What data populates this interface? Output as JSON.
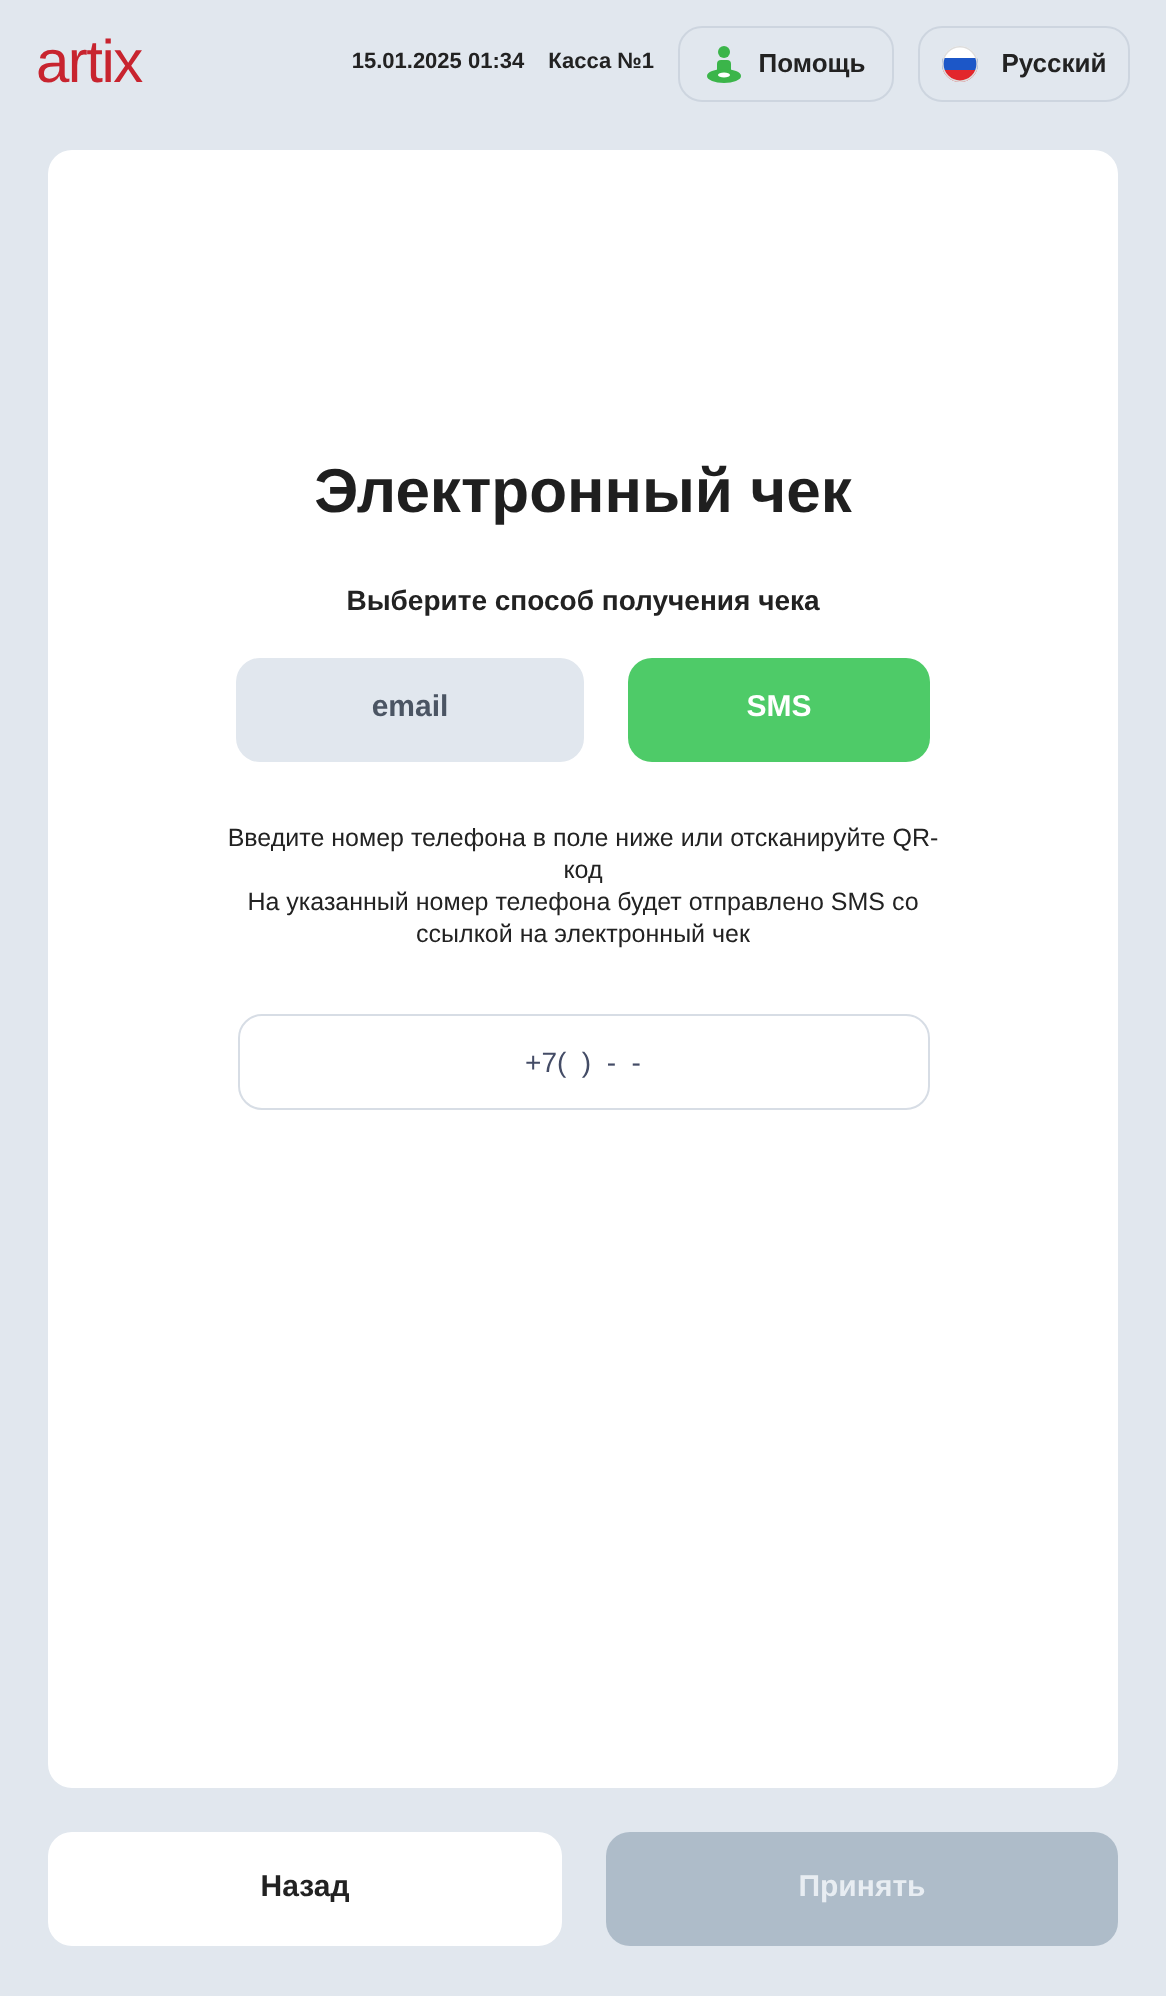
{
  "header": {
    "logo": "artix",
    "datetime": "15.01.2025 01:34",
    "register": "Касса №1",
    "help_button": "Помощь",
    "language_button": "Русский"
  },
  "title": "Электронный чек",
  "subtitle": "Выберите способ получения чека",
  "methods": [
    {
      "label": "email",
      "selected": false
    },
    {
      "label": "SMS",
      "selected": true
    }
  ],
  "instructions": [
    "Введите номер телефона в поле ниже или отсканируйте QR-код",
    "На указанный номер телефона будет отправлено SMS со ссылкой на электронный чек"
  ],
  "phone_field": {
    "value": "+7(  )  -  -"
  },
  "footer": {
    "back_button": "Назад",
    "accept_button": {
      "label": "Принять",
      "disabled": true
    }
  }
}
